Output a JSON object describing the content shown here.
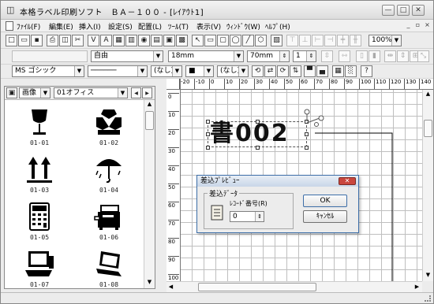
{
  "window": {
    "title": "本格ラベル印刷ソフト　ＢＡ－１００ - [ﾚｲｱｳﾄ1]",
    "min_glyph": "—",
    "max_glyph": "□",
    "close_glyph": "✕"
  },
  "menu": {
    "items": [
      "ﾌｧｲﾙ(F)",
      "編集(E)",
      "挿入(I)",
      "設定(S)",
      "配置(L)",
      "ﾂｰﾙ(T)",
      "表示(V)",
      "ｳｨﾝﾄﾞｳ(W)",
      "ﾍﾙﾌﾟ(H)"
    ],
    "mdi_min": "_",
    "mdi_restore": "▫",
    "mdi_close": "×"
  },
  "toolbar1": {
    "buttons": [
      {
        "icon": "new-icon",
        "glyph": "□"
      },
      {
        "icon": "open-icon",
        "glyph": "▭"
      },
      {
        "icon": "save-icon",
        "glyph": "▪"
      },
      {
        "icon": "print-icon",
        "glyph": "⎙"
      },
      {
        "icon": "preview-icon",
        "glyph": "◫"
      },
      {
        "icon": "cut-icon",
        "glyph": "✂"
      },
      {
        "icon": "format-icon",
        "glyph": "Ⅴ"
      },
      {
        "icon": "text-icon",
        "glyph": "A"
      },
      {
        "icon": "image-icon",
        "glyph": "▦"
      },
      {
        "icon": "barcode-icon",
        "glyph": "▥"
      },
      {
        "icon": "symbol-icon",
        "glyph": "◉"
      },
      {
        "icon": "table-icon",
        "glyph": "▤"
      },
      {
        "icon": "frame-icon",
        "glyph": "▣"
      },
      {
        "icon": "calendar-icon",
        "glyph": "▩"
      },
      {
        "icon": "pointer-icon",
        "glyph": "↖"
      },
      {
        "icon": "rect-icon",
        "glyph": "▭"
      },
      {
        "icon": "round-rect-icon",
        "glyph": "▢"
      },
      {
        "icon": "ellipse-icon",
        "glyph": "◯"
      },
      {
        "icon": "line-icon",
        "glyph": "╱"
      },
      {
        "icon": "poly-icon",
        "glyph": "⬡"
      },
      {
        "icon": "layout-icon",
        "glyph": "▧"
      },
      {
        "icon": "align-top-icon",
        "glyph": "⊤"
      },
      {
        "icon": "align-bottom-icon",
        "glyph": "⊥"
      },
      {
        "icon": "align-left-icon",
        "glyph": "⊢"
      },
      {
        "icon": "align-right-icon",
        "glyph": "⊣"
      },
      {
        "icon": "center-h-icon",
        "glyph": "╪"
      },
      {
        "icon": "center-v-icon",
        "glyph": "╫"
      }
    ],
    "zoom": "100%"
  },
  "toolbar2": {
    "font_style": "自由",
    "font_size": "18mm",
    "text_width": "70mm",
    "char_space": "1",
    "buttons": [
      {
        "icon": "spacing-icon",
        "glyph": "⇳"
      },
      {
        "icon": "even-icon",
        "glyph": "⇿"
      },
      {
        "icon": "box-left-icon",
        "glyph": "▯"
      },
      {
        "icon": "box-right-icon",
        "glyph": "▮"
      },
      {
        "icon": "dist-h-icon",
        "glyph": "⇹"
      },
      {
        "icon": "dist-v-icon",
        "glyph": "⇕"
      },
      {
        "icon": "grid-snap-icon",
        "glyph": "⊞"
      },
      {
        "icon": "resize-icon",
        "glyph": "⤡"
      }
    ]
  },
  "toolbar3": {
    "font_name": "MS ゴシック",
    "line_style": "──────",
    "fill_none": "(なし)",
    "pen_color": "■",
    "fill_pattern": "(なし)",
    "buttons": [
      {
        "icon": "rotate-icon",
        "glyph": "⟲"
      },
      {
        "icon": "mirror-icon",
        "glyph": "⇄"
      },
      {
        "icon": "rotate-90-icon",
        "glyph": "⟳"
      },
      {
        "icon": "flip-icon",
        "glyph": "⇅"
      },
      {
        "icon": "bring-front-icon",
        "glyph": "▀"
      },
      {
        "icon": "send-back-icon",
        "glyph": "▄"
      },
      {
        "icon": "hatch-icon",
        "glyph": "▦"
      },
      {
        "icon": "shade-icon",
        "glyph": "░"
      },
      {
        "icon": "help-icon",
        "glyph": "?"
      }
    ]
  },
  "symbol_panel": {
    "category": "画像",
    "folder": "01オフィス",
    "nav_prev": "◀",
    "nav_next": "▶",
    "items": [
      {
        "code": "01-01",
        "icon": "fragile-glass-icon"
      },
      {
        "code": "01-02",
        "icon": "handle-with-care-icon"
      },
      {
        "code": "01-03",
        "icon": "this-way-up-icon"
      },
      {
        "code": "01-04",
        "icon": "keep-dry-umbrella-icon"
      },
      {
        "code": "01-05",
        "icon": "calculator-icon"
      },
      {
        "code": "01-06",
        "icon": "copier-icon"
      },
      {
        "code": "01-07",
        "icon": "computer-icon"
      },
      {
        "code": "01-08",
        "icon": "laptop-icon"
      }
    ]
  },
  "ruler": {
    "h_ticks": [
      "-20",
      "-10",
      "0",
      "10",
      "20",
      "30",
      "40",
      "50",
      "60",
      "70",
      "80",
      "90",
      "100",
      "110",
      "120",
      "130",
      "140"
    ],
    "v_ticks": [
      "0",
      "10",
      "20",
      "30",
      "40",
      "50",
      "60",
      "70",
      "80",
      "90",
      "100"
    ]
  },
  "label_object": {
    "text": "書002"
  },
  "dialog": {
    "title": "差込ﾌﾟﾚﾋﾞｭｰ",
    "group_label": "差込ﾃﾞｰﾀ",
    "record_label": "ﾚｺｰﾄﾞ番号(R)",
    "record_value": "0",
    "ok": "OK",
    "cancel": "ｷｬﾝｾﾙ"
  },
  "colors": {
    "dialog_border": "#3d6ea8",
    "close_red": "#c9463d",
    "grid": "#bfbfbf"
  }
}
